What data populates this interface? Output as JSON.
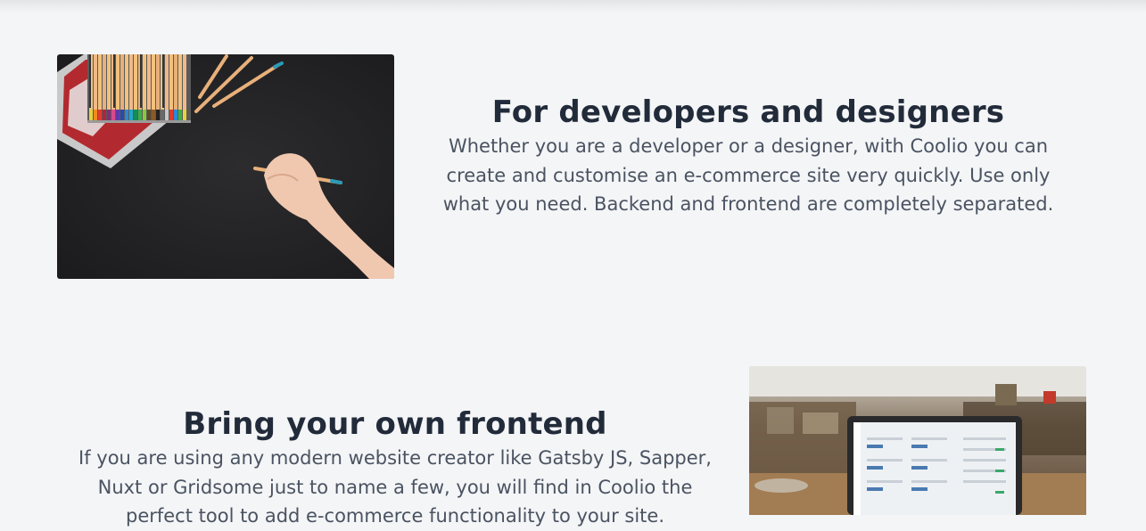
{
  "sections": [
    {
      "heading": "For developers and designers",
      "body": "Whether you are a developer or a designer, with Coolio you can create and customise an e-commerce site very quickly. Use only what you need. Backend and frontend are completely separated.",
      "image_icon": "pencils-desk-photo"
    },
    {
      "heading": "Bring your own frontend",
      "body": "If you are using any modern website creator like Gatsby JS, Sapper, Nuxt or Gridsome just to name a few, you will find in Coolio the perfect tool to add e-commerce functionality to your site.",
      "image_icon": "laptop-dashboard-photo"
    }
  ],
  "colors": {
    "background": "#f4f5f7",
    "heading": "#222b3a",
    "body": "#4a5361"
  }
}
